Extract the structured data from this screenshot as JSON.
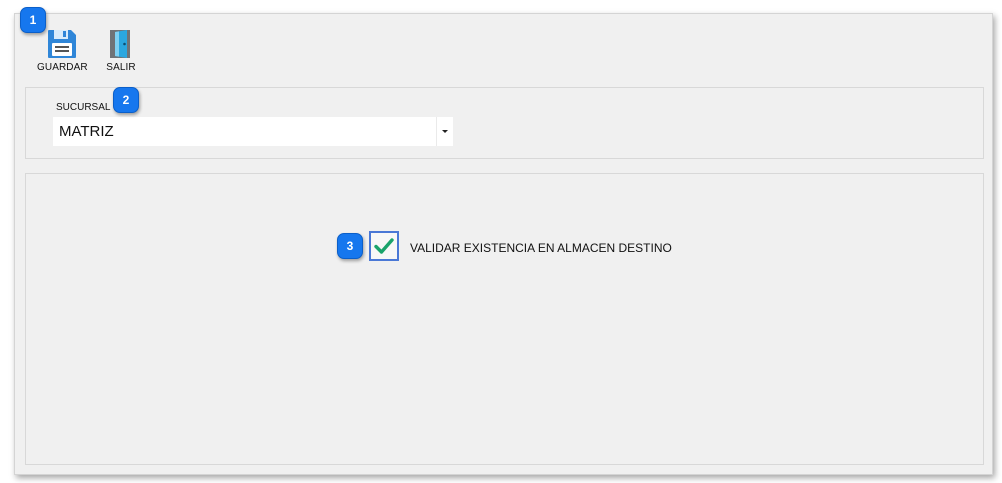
{
  "toolbar": {
    "save": {
      "label": "GUARDAR",
      "icon": "floppy-disk-icon"
    },
    "exit": {
      "label": "SALIR",
      "icon": "exit-door-icon"
    }
  },
  "branch": {
    "label": "SUCURSAL",
    "selected": "MATRIZ"
  },
  "options": {
    "validate_stock": {
      "label": "VALIDAR EXISTENCIA EN ALMACEN DESTINO",
      "checked": true
    }
  },
  "callouts": [
    "1",
    "2",
    "3"
  ],
  "colors": {
    "accent": "#1677ee",
    "check": "#1aa36b",
    "checkbox_border": "#4a78d6",
    "window_bg": "#f0f0f0"
  }
}
